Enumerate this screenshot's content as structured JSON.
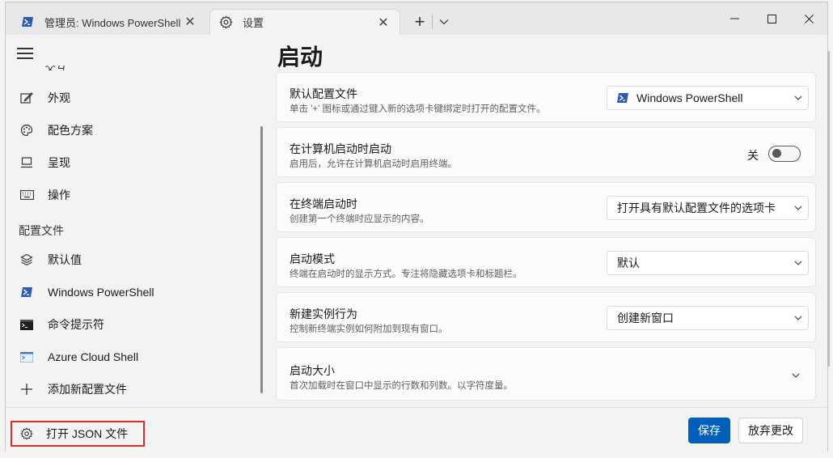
{
  "colors": {
    "accent": "#005fb8",
    "highlight_border": "#e02a2a",
    "powershell_blue": "#2a5cb8"
  },
  "tabs": [
    {
      "label": "管理员: Windows PowerShell",
      "icon": "powershell-icon",
      "active": false
    },
    {
      "label": "设置",
      "icon": "gear-icon",
      "active": true
    }
  ],
  "sidebar": {
    "partial_item": "交互",
    "items": [
      {
        "label": "外观",
        "icon": "appearance-icon"
      },
      {
        "label": "配色方案",
        "icon": "palette-icon"
      },
      {
        "label": "呈现",
        "icon": "monitor-icon"
      },
      {
        "label": "操作",
        "icon": "keyboard-icon"
      }
    ],
    "profiles_header": "配置文件",
    "profiles": [
      {
        "label": "默认值",
        "icon": "layers-icon"
      },
      {
        "label": "Windows PowerShell",
        "icon": "powershell-icon"
      },
      {
        "label": "命令提示符",
        "icon": "cmd-icon"
      },
      {
        "label": "Azure Cloud Shell",
        "icon": "azure-icon"
      },
      {
        "label": "添加新配置文件",
        "icon": "plus-icon"
      }
    ],
    "open_json": "打开 JSON 文件"
  },
  "main": {
    "title": "启动",
    "settings": [
      {
        "title": "默认配置文件",
        "desc": "单击 '+' 图标或通过键入新的选项卡键绑定时打开的配置文件。",
        "value": "Windows PowerShell"
      },
      {
        "title": "在计算机启动时启动",
        "desc": "启用后，允许在计算机启动时启用终端。",
        "toggle_label": "关",
        "toggle_on": false
      },
      {
        "title": "在终端启动时",
        "desc": "创建第一个终端时应显示的内容。",
        "value": "打开具有默认配置文件的选项卡"
      },
      {
        "title": "启动模式",
        "desc": "终端在启动时的显示方式。专注将隐藏选项卡和标题栏。",
        "value": "默认"
      },
      {
        "title": "新建实例行为",
        "desc": "控制新终端实例如何附加到现有窗口。",
        "value": "创建新窗口"
      },
      {
        "title": "启动大小",
        "desc": "首次加载时在窗口中显示的行数和列数。以字符度量。"
      }
    ]
  },
  "footer": {
    "save": "保存",
    "discard": "放弃更改"
  }
}
